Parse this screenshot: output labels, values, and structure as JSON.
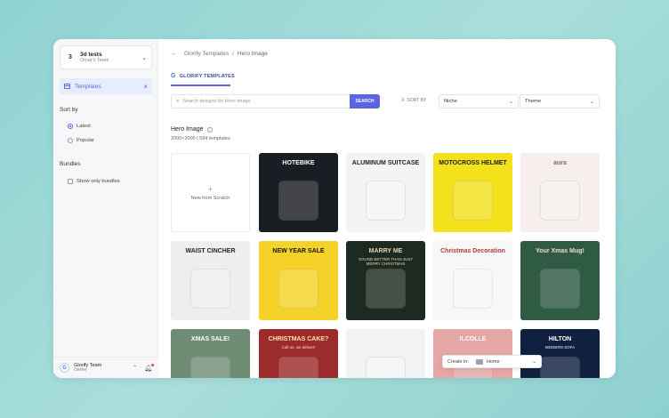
{
  "project": {
    "number": "3",
    "name": "3d tests",
    "team": "Omar's Team"
  },
  "nav": {
    "templates_label": "Templates"
  },
  "sort": {
    "title": "Sort by",
    "options": [
      {
        "label": "Latest",
        "selected": true
      },
      {
        "label": "Popular",
        "selected": false
      }
    ]
  },
  "bundles": {
    "title": "Bundles",
    "show_only_label": "Show only bundles"
  },
  "team": {
    "initial": "G",
    "name": "Glorify Team",
    "role": "Owner"
  },
  "breadcrumb": {
    "root": "Glorify Templates",
    "separator": "/",
    "current": "Hero Image"
  },
  "tab": {
    "logo": "G",
    "label": "GLORIFY TEMPLATES"
  },
  "search": {
    "placeholder": "Search designs for Hero Image",
    "button": "SEARCH"
  },
  "sortbar": {
    "label": "SORT BY",
    "niche": "Niche",
    "theme": "Theme"
  },
  "category": {
    "title": "Hero Image",
    "meta": "2000×2000 | 584 templates"
  },
  "new_card": {
    "plus": "+",
    "label": "New from Scratch"
  },
  "templates": [
    {
      "title": "HOTEBIKE",
      "bg": "#1b1d24",
      "fg": "#ffffff"
    },
    {
      "title": "ALUMINUM SUITCASE",
      "bg": "#f4f4f4",
      "fg": "#222222"
    },
    {
      "title": "MOTOCROSS HELMET",
      "bg": "#f2e11b",
      "fg": "#222222"
    },
    {
      "title": "aura",
      "bg": "#f6efed",
      "fg": "#8a6a5a"
    },
    {
      "title": "WAIST CINCHER",
      "bg": "#eeeeee",
      "fg": "#222222"
    },
    {
      "title": "NEW YEAR SALE",
      "bg": "#f5d228",
      "fg": "#111111"
    },
    {
      "title": "MARRY ME",
      "bg": "#1d2a22",
      "fg": "#e7d6b0",
      "subtitle": "SOUND BETTER THAN JUST MERRY CHRISTMAS"
    },
    {
      "title": "Christmas Decoration",
      "bg": "#f7f7f7",
      "fg": "#b23a3a"
    },
    {
      "title": "Your Xmas Mug!",
      "bg": "#2f5a44",
      "fg": "#e9e1c2"
    },
    {
      "title": "XMAS SALE!",
      "bg": "#6f8d74",
      "fg": "#ffffff"
    },
    {
      "title": "CHRISTMAS CAKE?",
      "bg": "#9c2b2b",
      "fg": "#ffe0b5",
      "subtitle": "Call us, we deliver!"
    },
    {
      "title": "",
      "bg": "#f3f3f3",
      "fg": "#222222"
    },
    {
      "title": "ILCOLLE",
      "bg": "#e5a6a6",
      "fg": "#ffffff"
    },
    {
      "title": "HILTON",
      "bg": "#0f2040",
      "fg": "#ffffff",
      "subtitle": "MODERN SOFA"
    }
  ],
  "create_in": {
    "label": "Create in:",
    "value": "Home"
  }
}
